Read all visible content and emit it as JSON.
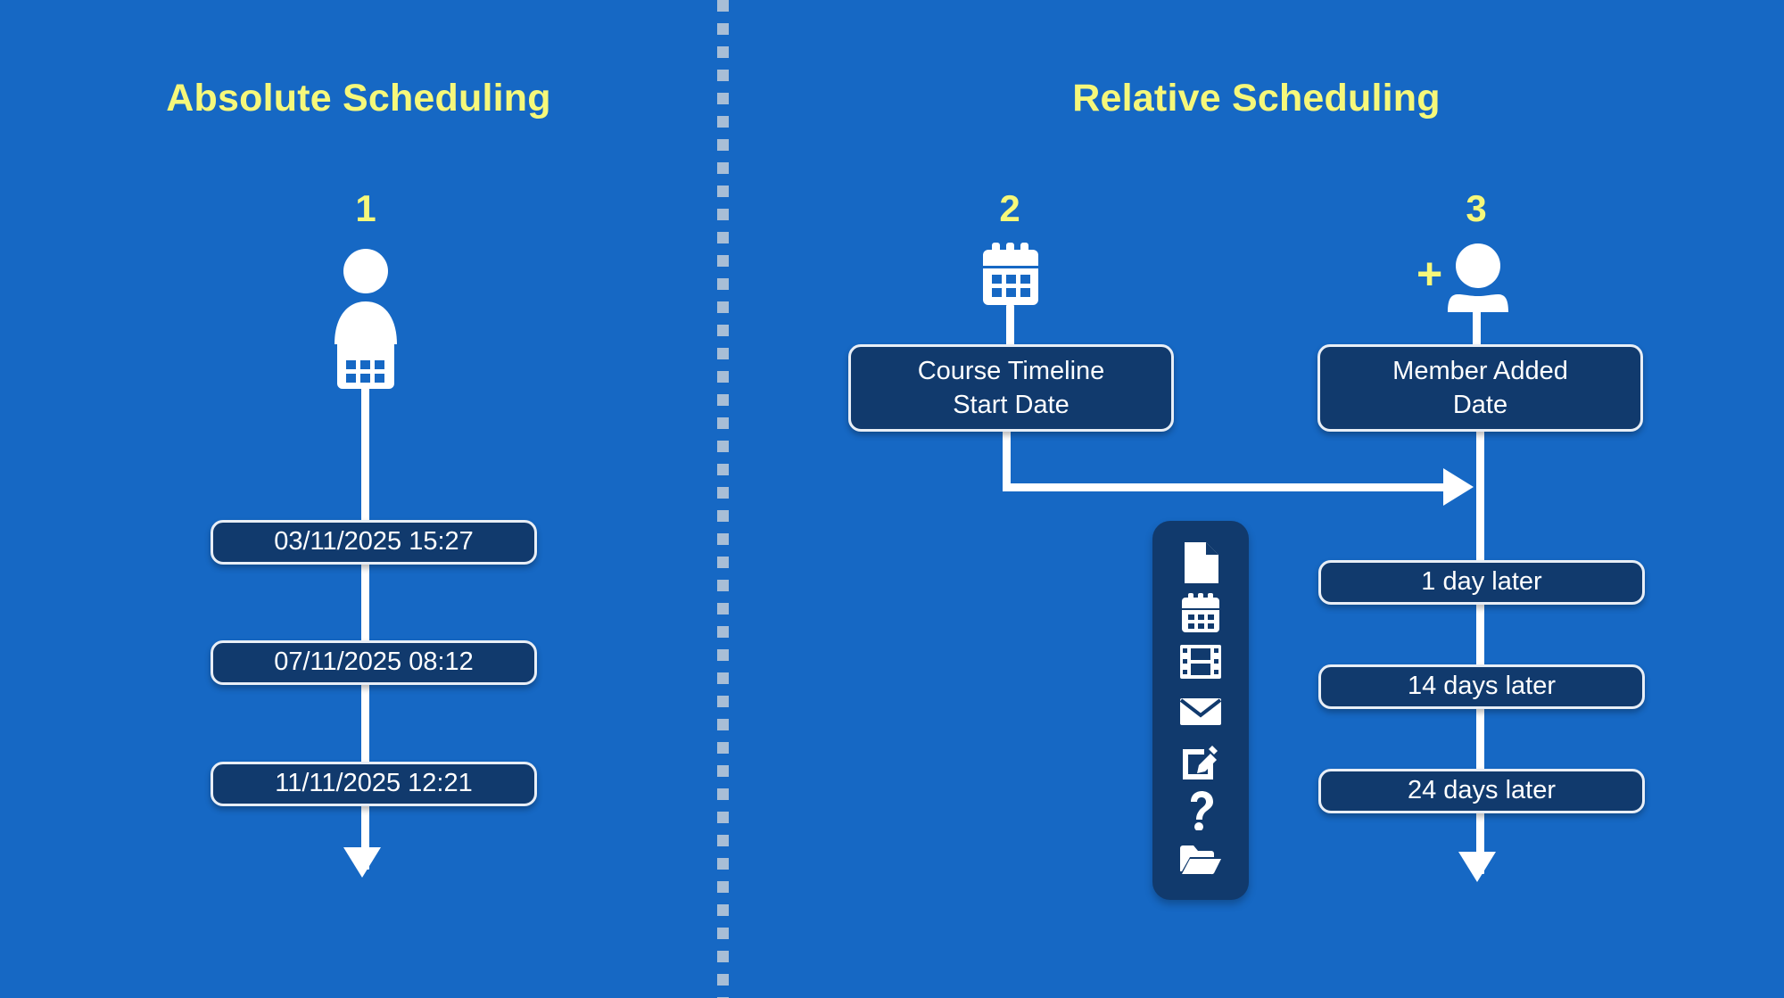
{
  "slide": {
    "background_color": "#1668c4",
    "accent_color": "#f6f87a",
    "box_fill_color": "#113a6d",
    "line_color": "#ffffff",
    "divider_color": "#a8bed6"
  },
  "sections": {
    "left": {
      "title": "Absolute Scheduling",
      "steps": [
        {
          "number": "1",
          "icon": "person-calendar-icon",
          "items": [
            {
              "label": "03/11/2025 15:27"
            },
            {
              "label": "07/11/2025 08:12"
            },
            {
              "label": "11/11/2025 12:21"
            }
          ]
        }
      ]
    },
    "right": {
      "title": "Relative Scheduling",
      "steps": [
        {
          "number": "2",
          "icon": "calendar-icon",
          "anchor_label_line1": "Course Timeline",
          "anchor_label_line2": "Start Date",
          "items": []
        },
        {
          "number": "3",
          "icon": "add-person-icon",
          "plus": "+",
          "anchor_label_line1": "Member Added",
          "anchor_label_line2": "Date",
          "items": [
            {
              "label": "1 day later"
            },
            {
              "label": "14 days later"
            },
            {
              "label": "24 days later"
            }
          ]
        }
      ]
    }
  },
  "icon_rail": {
    "icons": [
      "document-icon",
      "calendar-icon",
      "film-strip-icon",
      "envelope-icon",
      "edit-icon",
      "question-mark-icon",
      "open-folder-icon"
    ]
  }
}
